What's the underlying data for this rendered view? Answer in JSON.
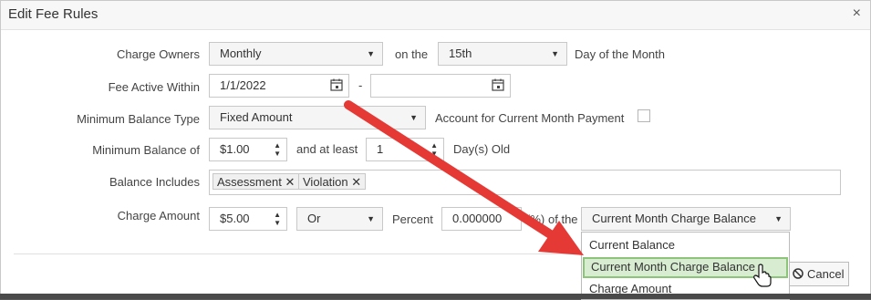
{
  "dialog": {
    "title": "Edit Fee Rules",
    "close": "×"
  },
  "labels": {
    "charge_owners": "Charge Owners",
    "on_the": "on the",
    "day_of_month": "Day of the Month",
    "fee_active_within": "Fee Active Within",
    "dash": "-",
    "minimum_balance_type": "Minimum Balance Type",
    "account_current_month": "Account for Current Month Payment",
    "minimum_balance_of": "Minimum Balance of",
    "and_at_least": "and at least",
    "days_old": "Day(s) Old",
    "balance_includes": "Balance Includes",
    "charge_amount": "Charge Amount",
    "percent": "Percent",
    "pct_suffix": "(%)",
    "of_the": "of the"
  },
  "fields": {
    "frequency": "Monthly",
    "day": "15th",
    "fee_start": "1/1/2022",
    "fee_end": "",
    "min_balance_type": "Fixed Amount",
    "min_balance": "$1.00",
    "days": "1",
    "charge_amount": "$5.00",
    "or_select": "Or",
    "percent": "0.000000",
    "of_the_select": "Current Month Charge Balance"
  },
  "balance_tags": [
    "Assessment",
    "Violation"
  ],
  "dropdown_options": [
    "Current Balance",
    "Current Month Charge Balance",
    "Charge Amount"
  ],
  "buttons": {
    "cancel": "Cancel"
  },
  "colors": {
    "arrow": "#e53935",
    "selected_bg": "#d7ecd0",
    "selected_border": "#8cc47a"
  }
}
